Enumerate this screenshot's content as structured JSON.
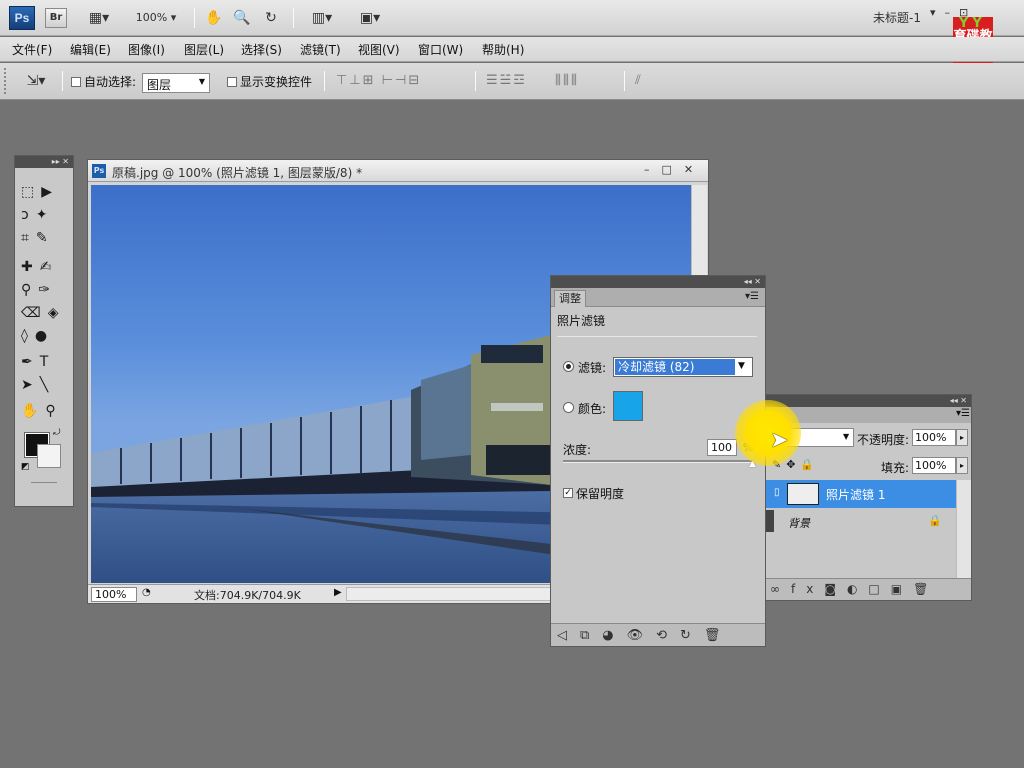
{
  "app": {
    "logo": "Ps",
    "bridge": "Br",
    "zoom": "100%",
    "doc_name": "未标题-1",
    "badge_top": "YY",
    "badge_text": "育碟教育"
  },
  "menubar": [
    {
      "label": "文件(F)"
    },
    {
      "label": "编辑(E)"
    },
    {
      "label": "图像(I)"
    },
    {
      "label": "图层(L)"
    },
    {
      "label": "选择(S)"
    },
    {
      "label": "滤镜(T)"
    },
    {
      "label": "视图(V)"
    },
    {
      "label": "窗口(W)"
    },
    {
      "label": "帮助(H)"
    }
  ],
  "options": {
    "auto_select": "自动选择:",
    "auto_select_value": "图层",
    "show_transform": "显示变换控件"
  },
  "document": {
    "title": "原稿.jpg @ 100% (照片滤镜 1, 图层蒙版/8) *",
    "zoom": "100%",
    "status": "文档:704.9K/704.9K"
  },
  "adjustments": {
    "tab": "调整",
    "title": "照片滤镜",
    "filter_label": "滤镜:",
    "filter_value": "冷却滤镜 (82)",
    "color_label": "颜色:",
    "color": "#17a4e8",
    "density_label": "浓度:",
    "density_value": "100",
    "density_unit": "%",
    "preserve_label": "保留明度"
  },
  "layers": {
    "opacity_label": "不透明度:",
    "opacity_value": "100%",
    "fill_label": "填充:",
    "fill_value": "100%",
    "items": [
      {
        "name": "照片滤镜 1",
        "selected": true
      },
      {
        "name": "背景",
        "selected": false
      }
    ]
  }
}
